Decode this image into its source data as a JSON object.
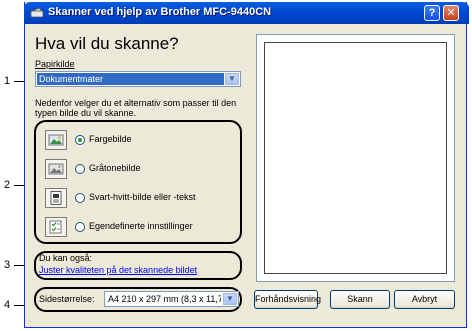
{
  "window": {
    "title": "Skanner ved hjelp av Brother MFC-9440CN",
    "help_label": "?",
    "close_label": "✕"
  },
  "main": {
    "heading": "Hva vil du skanne?",
    "paper_source_label": "Papirkilde",
    "paper_source_value": "Dokumentmater",
    "description": "Nedenfor velger du et alternativ som passer til den typen bilde du vil skanne.",
    "options": [
      {
        "label": "Fargebilde",
        "selected": true,
        "icon": "color-picture-icon"
      },
      {
        "label": "Gråtonebilde",
        "selected": false,
        "icon": "grayscale-picture-icon"
      },
      {
        "label": "Svart-hvitt-bilde eller -tekst",
        "selected": false,
        "icon": "black-white-text-icon"
      },
      {
        "label": "Egendefinerte innstillinger",
        "selected": false,
        "icon": "custom-settings-icon"
      }
    ],
    "also_label": "Du kan også:",
    "adjust_link": "Juster kvaliteten på det skannede bildet",
    "page_size_label": "Sidestørrelse:",
    "page_size_value": "A4 210 x 297 mm (8,3 x 11,7"
  },
  "buttons": {
    "preview": "Forhåndsvisning",
    "scan": "Skann",
    "cancel": "Avbryt"
  },
  "callouts": [
    "1",
    "2",
    "3",
    "4"
  ],
  "colors": {
    "title_bar": "#0049d3",
    "selection": "#316ac5",
    "link": "#0000ff",
    "window_face": "#ece9d8"
  }
}
